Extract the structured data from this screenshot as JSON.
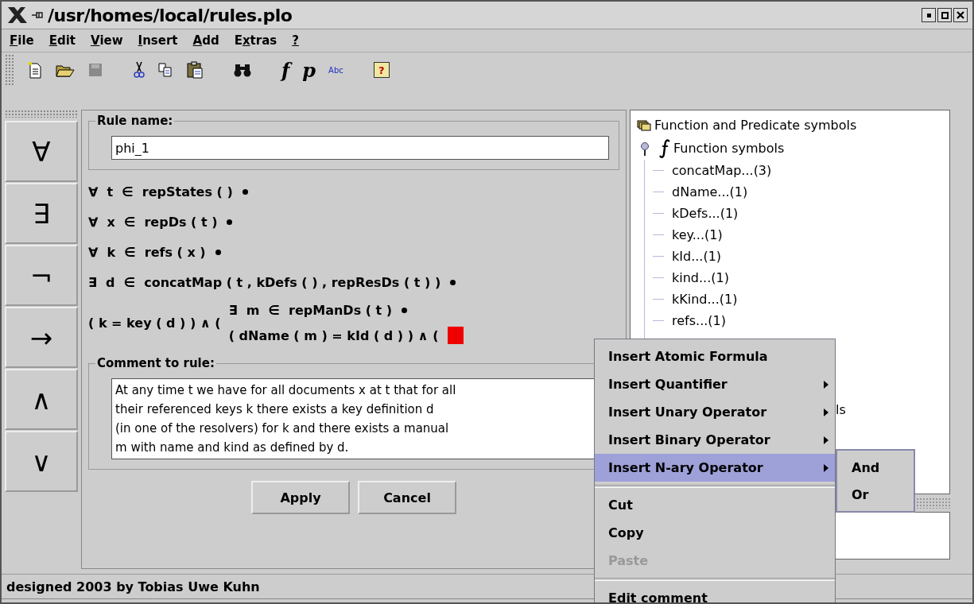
{
  "window": {
    "title": "/usr/homes/local/rules.plo"
  },
  "menubar": [
    {
      "key": "F",
      "post": "ile"
    },
    {
      "key": "E",
      "post": "dit"
    },
    {
      "key": "V",
      "post": "iew"
    },
    {
      "key": "I",
      "post": "nsert"
    },
    {
      "key": "A",
      "post": "dd"
    },
    {
      "pre": "E",
      "key": "x",
      "post": "tras"
    },
    {
      "key": "?"
    }
  ],
  "toolbar": [
    {
      "kind": "new",
      "disabled": false
    },
    {
      "kind": "open",
      "disabled": false
    },
    {
      "kind": "save",
      "disabled": true
    },
    {
      "kind": "gap"
    },
    {
      "kind": "cut",
      "disabled": false
    },
    {
      "kind": "copy",
      "disabled": false
    },
    {
      "kind": "paste",
      "disabled": false
    },
    {
      "kind": "gap"
    },
    {
      "kind": "find",
      "disabled": false
    },
    {
      "kind": "gap"
    },
    {
      "kind": "function",
      "label": "f",
      "disabled": false
    },
    {
      "kind": "predicate",
      "label": "p",
      "disabled": false
    },
    {
      "kind": "abc",
      "label": "Abc",
      "disabled": false
    },
    {
      "kind": "gap"
    },
    {
      "kind": "help",
      "label": "?",
      "disabled": false
    }
  ],
  "operator_buttons": [
    "∀",
    "∃",
    "¬",
    "→",
    "∧",
    "∨"
  ],
  "rule_name": {
    "label": "Rule name:",
    "value": "phi_1"
  },
  "formula": [
    {
      "kind": "quantifier",
      "symbol": "∀",
      "variable": "t",
      "relation": "∈",
      "domain": "repStates ( )"
    },
    {
      "kind": "quantifier",
      "symbol": "∀",
      "variable": "x",
      "relation": "∈",
      "domain": "repDs ( t )"
    },
    {
      "kind": "quantifier",
      "symbol": "∀",
      "variable": "k",
      "relation": "∈",
      "domain": "refs ( x )"
    },
    {
      "kind": "quantifier",
      "symbol": "∃",
      "variable": "d",
      "relation": "∈",
      "domain": "concatMap ( t , kDefs ( ) , repResDs ( t ) )"
    },
    {
      "kind": "conjunction",
      "left": "( k = key ( d ) ) ∧ (",
      "inner": {
        "symbol": "∃",
        "variable": "m",
        "relation": "∈",
        "domain": "repManDs ( t )"
      },
      "right": "( dName ( m ) = kId ( d ) ) ∧ (",
      "hole": true
    }
  ],
  "comment": {
    "label": "Comment to rule:",
    "lines": [
      "At any time t we have for all documents x at t that for all",
      "their referenced keys k there exists a key definition d",
      "(in one of the resolvers) for k and there exists a manual",
      "m with name and kind as defined by d."
    ]
  },
  "buttons": [
    "Apply",
    "Cancel"
  ],
  "tree": {
    "root": "Function and Predicate symbols",
    "children": [
      {
        "label": "Function symbols",
        "expanded": true,
        "children": [
          "concatMap...(3)",
          "dName...(1)",
          "kDefs...(1)",
          "key...(1)",
          "kId...(1)",
          "kind...(1)",
          "kKind...(1)",
          "refs...(1)"
        ]
      }
    ],
    "partial_item": "ls"
  },
  "context_menu": {
    "groups": [
      [
        {
          "label": "Insert Atomic Formula",
          "submenu": false,
          "selected": false,
          "disabled": false
        },
        {
          "label": "Insert Quantifier",
          "submenu": true,
          "selected": false,
          "disabled": false
        },
        {
          "label": "Insert Unary Operator",
          "submenu": true,
          "selected": false,
          "disabled": false
        },
        {
          "label": "Insert Binary Operator",
          "submenu": true,
          "selected": false,
          "disabled": false
        },
        {
          "label": "Insert N-ary Operator",
          "submenu": true,
          "selected": true,
          "disabled": false
        }
      ],
      [
        {
          "label": "Cut",
          "submenu": false,
          "selected": false,
          "disabled": false
        },
        {
          "label": "Copy",
          "submenu": false,
          "selected": false,
          "disabled": false
        },
        {
          "label": "Paste",
          "submenu": false,
          "selected": false,
          "disabled": true
        }
      ],
      [
        {
          "label": "Edit comment",
          "submenu": false,
          "selected": false,
          "disabled": false
        }
      ]
    ],
    "submenu": [
      {
        "label": "And",
        "selected": false
      },
      {
        "label": "Or",
        "selected": false
      }
    ]
  },
  "status_bar": "designed 2003 by Tobias Uwe Kuhn"
}
